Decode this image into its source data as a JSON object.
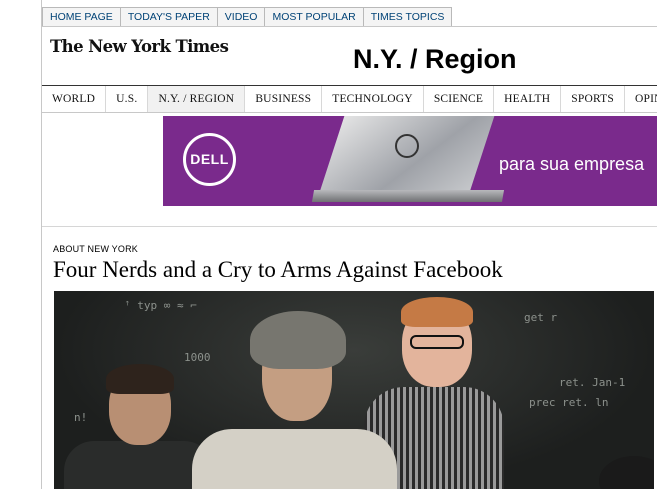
{
  "top_nav": {
    "tabs": [
      "HOME PAGE",
      "TODAY'S PAPER",
      "VIDEO",
      "MOST POPULAR",
      "TIMES TOPICS"
    ]
  },
  "masthead": {
    "logo_text": "The New York Times",
    "section_title": "N.Y. / Region"
  },
  "section_nav": {
    "items": [
      "WORLD",
      "U.S.",
      "N.Y. / REGION",
      "BUSINESS",
      "TECHNOLOGY",
      "SCIENCE",
      "HEALTH",
      "SPORTS",
      "OPINION"
    ],
    "active": "N.Y. / REGION"
  },
  "ad": {
    "brand": "DELL",
    "tagline": "para sua empresa",
    "background_color": "#7a2a8c"
  },
  "article": {
    "kicker": "ABOUT NEW YORK",
    "headline": "Four Nerds and a Cry to Arms Against Facebook"
  },
  "colors": {
    "nav_link": "#004276"
  }
}
